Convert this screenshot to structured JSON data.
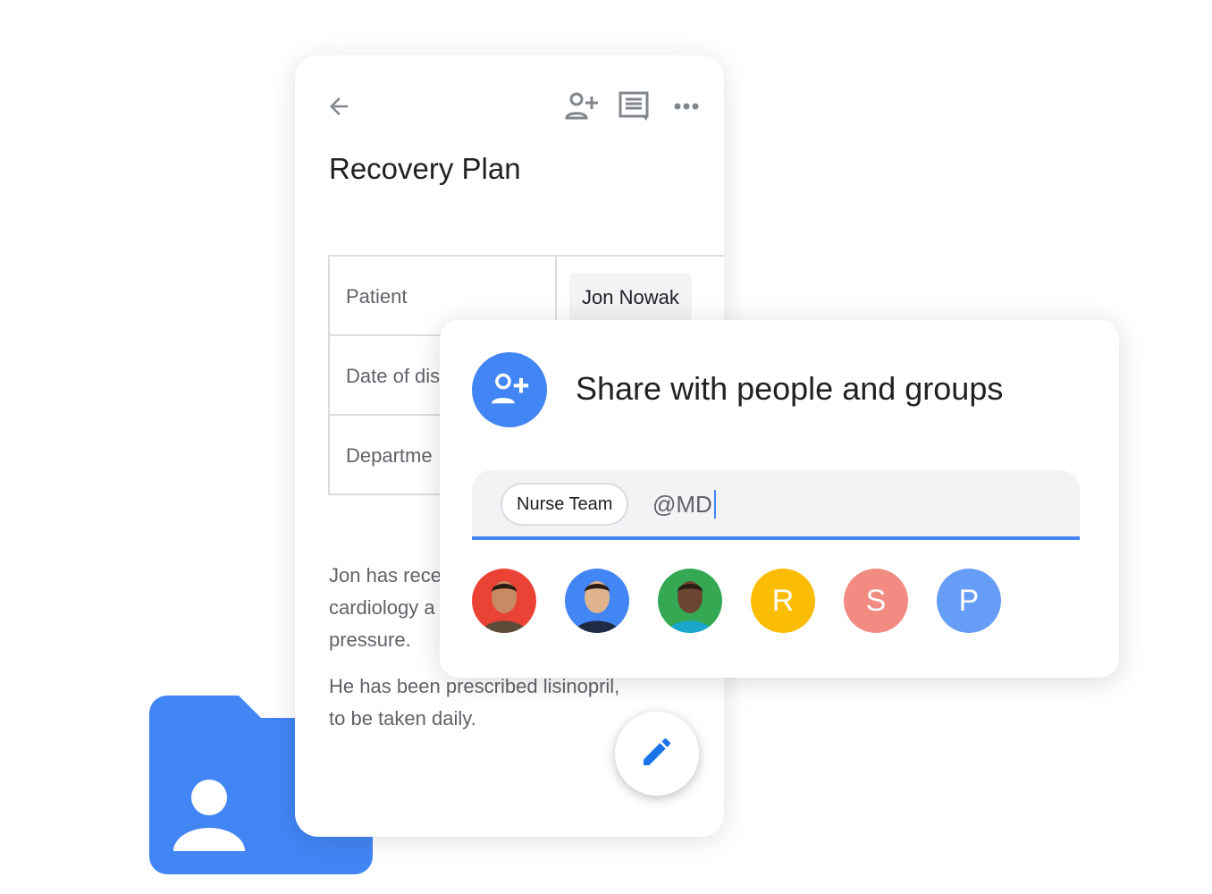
{
  "document": {
    "title": "Recovery Plan",
    "toolbar": {
      "back_icon": "arrow-left-icon",
      "share_icon": "person-add-icon",
      "comment_icon": "comment-icon",
      "more_icon": "more-horiz-icon"
    },
    "table": [
      {
        "label": "Patient",
        "value": "Jon Nowak"
      },
      {
        "label": "Date of dis",
        "value": ""
      },
      {
        "label": "Departme",
        "value": ""
      }
    ],
    "paragraphs": [
      [
        "Jon has rece",
        "cardiology a",
        "pressure."
      ],
      [
        "He has been prescribed lisinopril,",
        "to be taken daily."
      ]
    ],
    "fab_icon": "pencil-icon"
  },
  "share_dialog": {
    "title": "Share with people and groups",
    "icon": "person-add-icon",
    "chip": "Nurse Team",
    "input_value": "@MD",
    "avatars": [
      {
        "type": "photo",
        "color": "#ea4335"
      },
      {
        "type": "photo",
        "color": "#4285f4"
      },
      {
        "type": "photo",
        "color": "#34a853"
      },
      {
        "type": "letter",
        "letter": "R",
        "color": "#fbbc04"
      },
      {
        "type": "letter",
        "letter": "S",
        "color": "#f28b82"
      },
      {
        "type": "letter",
        "letter": "P",
        "color": "#669df6"
      }
    ]
  },
  "colors": {
    "accent": "#4285f4"
  }
}
